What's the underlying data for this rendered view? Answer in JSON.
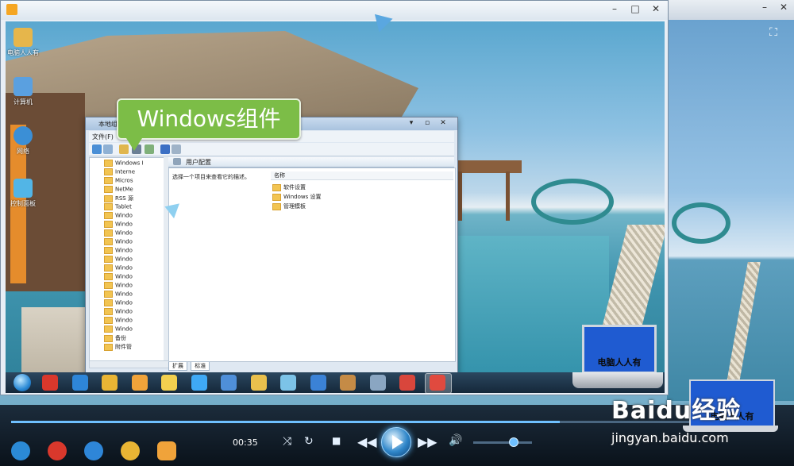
{
  "bg_player": {
    "time": "00:35",
    "seek_fraction": 0.72,
    "volume_fraction": 0.68,
    "fullscreen_icon": "fullscreen-icon"
  },
  "fg_player": {
    "title_buttons": [
      "–",
      "□",
      "✕"
    ]
  },
  "desktop": {
    "icons": [
      {
        "label": "电脑人人有",
        "icon": "folder-icon",
        "color": "#e6b64b"
      },
      {
        "label": "计算机",
        "icon": "computer-icon",
        "color": "#5aa0e0"
      },
      {
        "label": "网络",
        "icon": "network-icon",
        "color": "#3b8fd6"
      },
      {
        "label": "控制面板",
        "icon": "control-panel-icon",
        "color": "#52b5e6"
      }
    ]
  },
  "bubble": {
    "text": "Windows组件"
  },
  "explorer": {
    "title": "本地组",
    "menu": [
      "文件(F)"
    ],
    "tree": [
      "Windows I",
      "Interne",
      "Micros",
      "NetMe",
      "RSS 源",
      "Tablet",
      "Windo",
      "Windo",
      "Windo",
      "Windo",
      "Windo",
      "Windo",
      "Windo",
      "Windo",
      "Windo",
      "Windo",
      "Windo",
      "Windo",
      "Windo",
      "Windo",
      "备份",
      "附件管"
    ],
    "header": "用户配置",
    "description": "选择一个项目来查看它的描述。",
    "list_header": "名称",
    "items": [
      "软件设置",
      "Windows 设置",
      "管理模板"
    ],
    "tabs": [
      "扩展",
      "标准"
    ]
  },
  "laptop_logo": {
    "text": "电脑人人有"
  },
  "watermark": {
    "brand": "Baidu经验",
    "url": "jingyan.baidu.com"
  },
  "taskbar_icons": [
    {
      "name": "start-orb",
      "color": "#2b8ad6"
    },
    {
      "name": "app-red-icon",
      "color": "#d9382c"
    },
    {
      "name": "ie-icon",
      "color": "#2e86d8"
    },
    {
      "name": "chrome-icon",
      "color": "#e9b534"
    },
    {
      "name": "media-icon",
      "color": "#f0a33a"
    },
    {
      "name": "notes-icon",
      "color": "#f2d04f"
    },
    {
      "name": "qq-icon",
      "color": "#3fa9f5"
    },
    {
      "name": "remote-icon",
      "color": "#4f8fd9"
    },
    {
      "name": "explorer-icon",
      "color": "#e9c04d"
    },
    {
      "name": "recycle-icon",
      "color": "#7cc3e8"
    },
    {
      "name": "gear-blue-icon",
      "color": "#3b82d6"
    },
    {
      "name": "paint-icon",
      "color": "#c58b46"
    },
    {
      "name": "settings-icon",
      "color": "#8aa6c2"
    },
    {
      "name": "red-app-icon",
      "color": "#d9463c"
    },
    {
      "name": "red-app2-icon",
      "color": "#e04a3f"
    }
  ]
}
